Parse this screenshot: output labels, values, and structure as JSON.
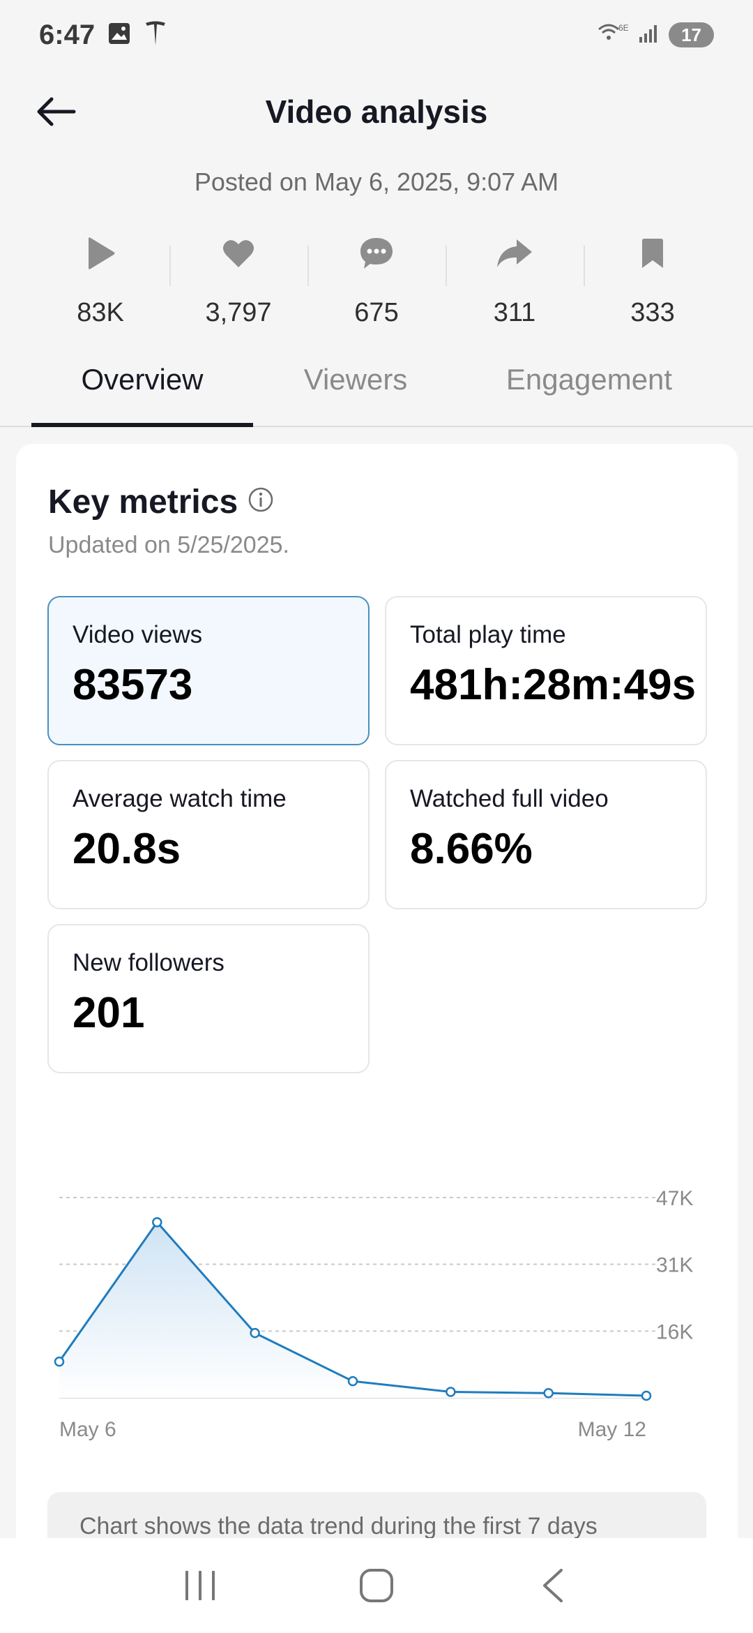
{
  "status_bar": {
    "time": "6:47",
    "battery": "17",
    "network": "6E"
  },
  "header": {
    "title": "Video analysis"
  },
  "posted": "Posted on May 6, 2025, 9:07 AM",
  "stats": [
    {
      "icon": "play-icon",
      "value": "83K"
    },
    {
      "icon": "heart-icon",
      "value": "3,797"
    },
    {
      "icon": "comment-icon",
      "value": "675"
    },
    {
      "icon": "share-icon",
      "value": "311"
    },
    {
      "icon": "bookmark-icon",
      "value": "333"
    }
  ],
  "tabs": [
    {
      "label": "Overview",
      "active": true
    },
    {
      "label": "Viewers",
      "active": false
    },
    {
      "label": "Engagement",
      "active": false
    }
  ],
  "key_metrics": {
    "title": "Key metrics",
    "updated": "Updated on 5/25/2025.",
    "items": [
      {
        "label": "Video views",
        "value": "83573",
        "selected": true
      },
      {
        "label": "Total play time",
        "value": "481h:28m:49s",
        "selected": false
      },
      {
        "label": "Average watch time",
        "value": "20.8s",
        "selected": false
      },
      {
        "label": "Watched full video",
        "value": "8.66%",
        "selected": false
      },
      {
        "label": "New followers",
        "value": "201",
        "selected": false
      }
    ]
  },
  "chart_data": {
    "type": "area",
    "title": "",
    "x": [
      "May 6",
      "May 7",
      "May 8",
      "May 9",
      "May 10",
      "May 11",
      "May 12"
    ],
    "x_tick_labels": [
      "May 6",
      "May 12"
    ],
    "series": [
      {
        "values": [
          8500,
          41200,
          15200,
          3900,
          1400,
          1100,
          500
        ]
      }
    ],
    "y_ticks": [
      "16K",
      "31K",
      "47K"
    ],
    "y_tick_values": [
      15667,
      31333,
      47000
    ],
    "ylim": [
      0,
      47000
    ],
    "grid": true,
    "color": "#1f7cbd"
  },
  "note": "Chart shows the data trend during the first 7 days",
  "colors": {
    "accent": "#1f7cbd",
    "selected_border": "#4a8fbf",
    "selected_bg": "#f2f8fd"
  }
}
